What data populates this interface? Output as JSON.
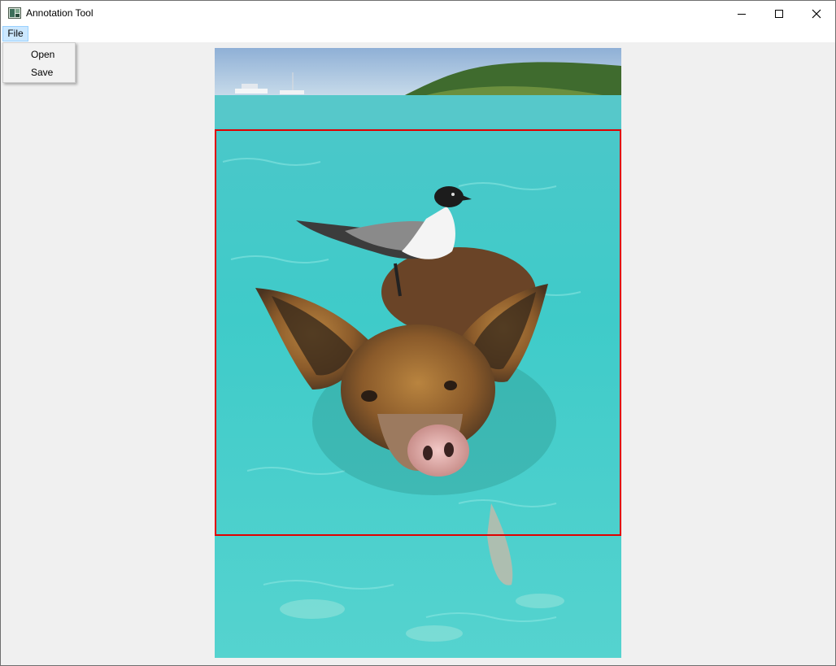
{
  "window": {
    "title": "Annotation Tool",
    "icon": "app-image-icon"
  },
  "window_controls": {
    "minimize_icon": "minimize-icon",
    "maximize_icon": "maximize-icon",
    "close_icon": "close-icon"
  },
  "menubar": {
    "file_label": "File"
  },
  "file_menu": {
    "items": [
      {
        "label": "Open"
      },
      {
        "label": "Save"
      }
    ]
  },
  "image": {
    "description_icon": "photo-canvas"
  },
  "annotation": {
    "box_color": "#e00000"
  }
}
